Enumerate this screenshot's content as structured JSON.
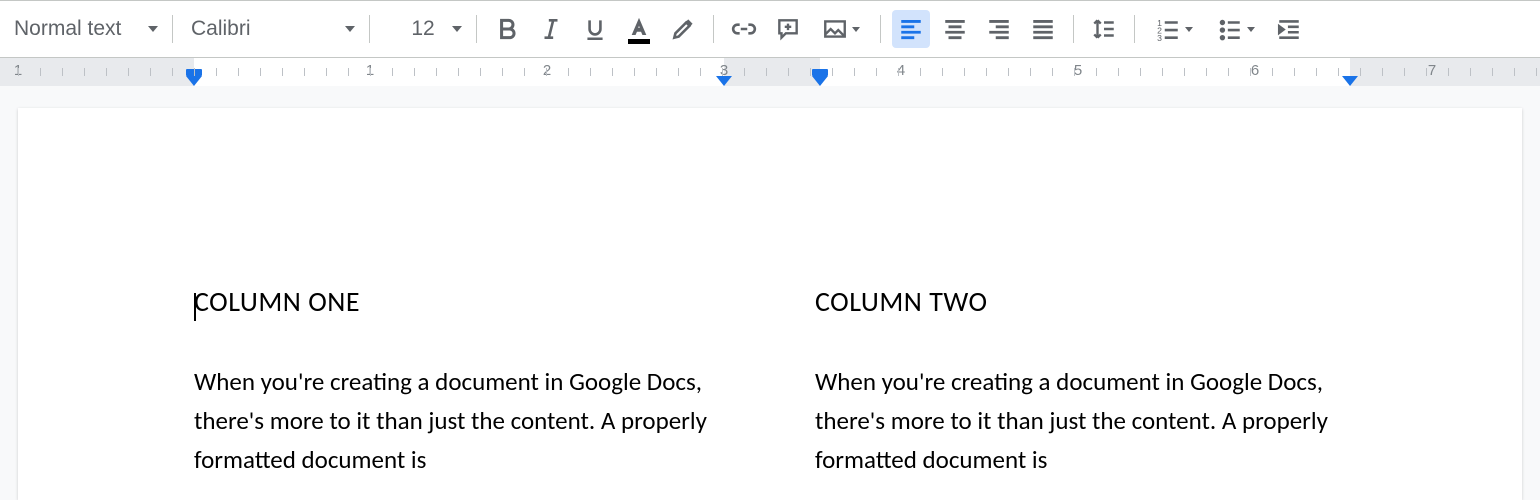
{
  "toolbar": {
    "style": "Normal text",
    "font": "Calibri",
    "size": "12"
  },
  "document": {
    "col1": {
      "heading": "COLUMN ONE",
      "body": "When you're creating a document in Google Docs, there's more to it than just the content. A properly formatted document is"
    },
    "col2": {
      "heading": "COLUMN TWO",
      "body": "When you're creating a document in Google Docs, there's more to it than just the content. A properly formatted document is"
    }
  },
  "ruler": {
    "marks": [
      "1",
      "1",
      "2",
      "3",
      "4",
      "5",
      "6",
      "7"
    ]
  }
}
